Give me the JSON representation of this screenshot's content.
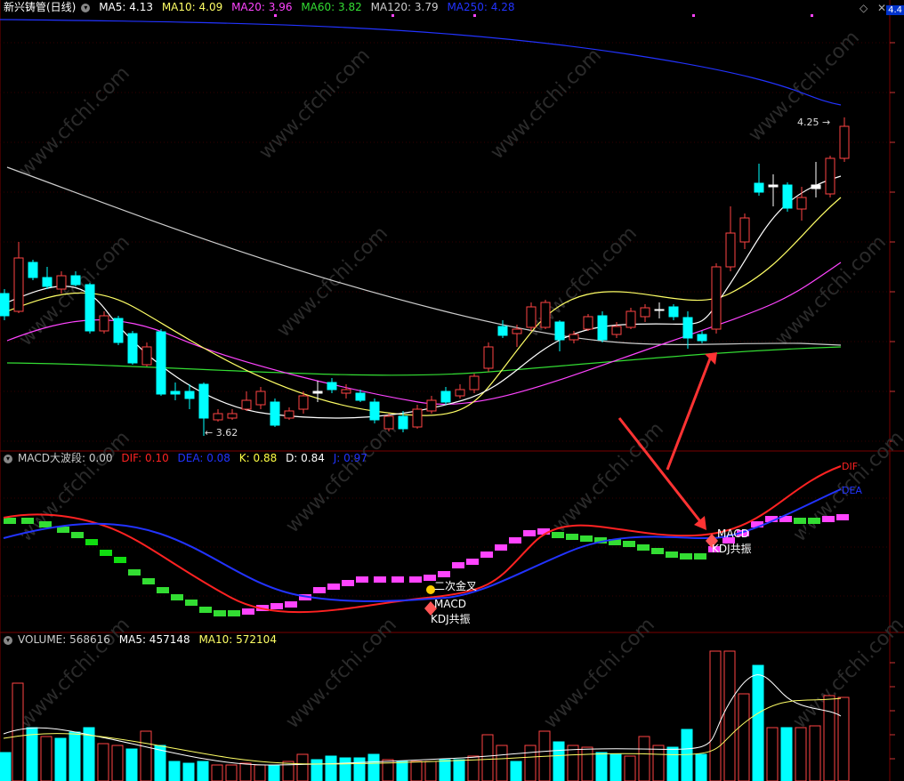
{
  "main": {
    "stock_name": "新兴铸管(日线)",
    "ma": [
      {
        "label": "MA5: 4.13",
        "color": "#ffffff"
      },
      {
        "label": "MA10: 4.09",
        "color": "#ffff66"
      },
      {
        "label": "MA20: 3.96",
        "color": "#ff44ff"
      },
      {
        "label": "MA60: 3.82",
        "color": "#33dd33"
      },
      {
        "label": "MA120: 3.79",
        "color": "#cccccc"
      },
      {
        "label": "MA250: 4.28",
        "color": "#2233ff"
      }
    ],
    "high_label": "4.25",
    "low_label": "3.62",
    "axis_top_label": "4.4"
  },
  "macd": {
    "title": "MACD大波段",
    "title_value": ": 0.00",
    "indicators": [
      {
        "label": "DIF: 0.10",
        "color": "#ff2222"
      },
      {
        "label": "DEA: 0.08",
        "color": "#2233ff"
      },
      {
        "label": "K: 0.88",
        "color": "#ffff44"
      },
      {
        "label": "D: 0.84",
        "color": "#ffffff"
      },
      {
        "label": "J: 0.97",
        "color": "#2233ff"
      }
    ],
    "signal_second_golden": "二次金叉",
    "signal_macd_1": "MACD",
    "signal_kdj_1": "KDJ共振",
    "signal_macd_2": "MACD",
    "signal_kdj_2": "KDJ共振",
    "line_label_dif": "DIF",
    "line_label_dea": "DEA"
  },
  "volume": {
    "title": "VOLUME: 568616",
    "ma5": "MA5: 457148",
    "ma10": "MA10: 572104"
  },
  "watermark": "www.cfchi.com",
  "colors": {
    "up": "#ff4444",
    "down": "#00ffff",
    "grid": "#7a0000"
  }
}
